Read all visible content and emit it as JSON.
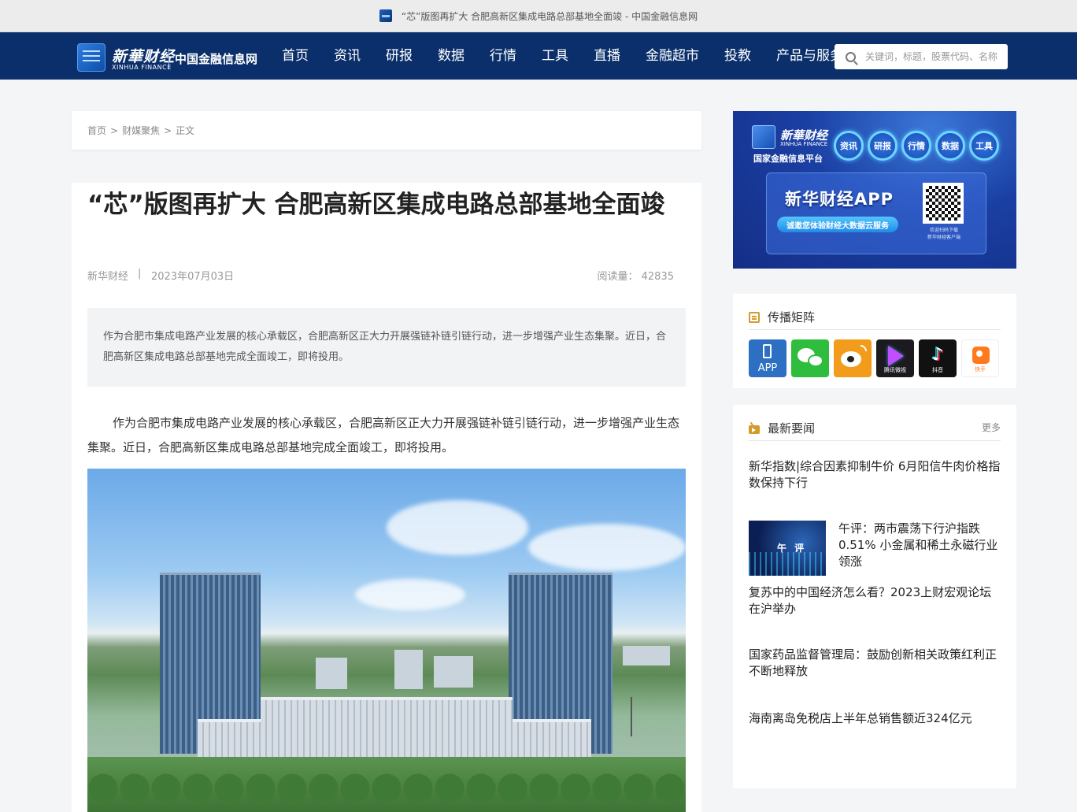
{
  "window": {
    "title": "“芯”版图再扩大 合肥高新区集成电路总部基地全面竣 - 中国金融信息网"
  },
  "header": {
    "brand_cn": "新華财经",
    "brand_en": "XINHUA FINANCE",
    "site_name": "中国金融信息网",
    "menu": [
      "首页",
      "资讯",
      "研报",
      "数据",
      "行情",
      "工具",
      "直播",
      "金融超市",
      "投教",
      "产品与服务"
    ],
    "search_placeholder": "关键词，标题，股票代码、名称"
  },
  "breadcrumb": {
    "home": "首页",
    "section": "财媒聚焦",
    "current": "正文",
    "sep": ">"
  },
  "article": {
    "title": "“芯”版图再扩大 合肥高新区集成电路总部基地全面竣",
    "source": "新华财经",
    "divider": "|",
    "date": "2023年07月03日",
    "read_label": "阅读量：",
    "read_count": "42835",
    "summary": "作为合肥市集成电路产业发展的核心承载区，合肥高新区正大力开展强链补链引链行动，进一步增强产业生态集聚。近日，合肥高新区集成电路总部基地完成全面竣工，即将投用。",
    "body": "作为合肥市集成电路产业发展的核心承载区，合肥高新区正大力开展强链补链引链行动，进一步增强产业生态集聚。近日，合肥高新区集成电路总部基地完成全面竣工，即将投用。"
  },
  "banner": {
    "brand_cn": "新華财经",
    "brand_en": "XINHUA FINANCE",
    "platform": "国家金融信息平台",
    "circles": [
      "资讯",
      "研报",
      "行情",
      "数据",
      "工具"
    ],
    "app_title": "新华财经APP",
    "pill": "诚邀您体验财经大数据云服务",
    "qr_caption_1": "欢迎扫码下载",
    "qr_caption_2": "新华财经客户端"
  },
  "matrix": {
    "title": "传播矩阵",
    "icons": [
      {
        "name": "app",
        "label": "APP"
      },
      {
        "name": "wechat",
        "label": ""
      },
      {
        "name": "weibo",
        "label": ""
      },
      {
        "name": "tencent-video",
        "label": "腾讯微视"
      },
      {
        "name": "douyin",
        "label": "抖音"
      },
      {
        "name": "kuaishou",
        "label": "快手"
      }
    ]
  },
  "news": {
    "title": "最新要闻",
    "more": "更多",
    "thumb_label": "午 评",
    "items": [
      "新华指数|综合因素抑制牛价 6月阳信牛肉价格指数保持下行",
      "午评：两市震荡下行沪指跌0.51% 小金属和稀土永磁行业领涨",
      "复苏中的中国经济怎么看？2023上财宏观论坛在沪举办",
      "国家药品监督管理局：鼓励创新相关政策红利正不断地释放",
      "海南离岛免税店上半年总销售额近324亿元"
    ]
  },
  "colors": {
    "nav_bg": "#0a2f6b",
    "accent_gold": "#d59a2c",
    "page_bg": "#f4f5f7"
  }
}
